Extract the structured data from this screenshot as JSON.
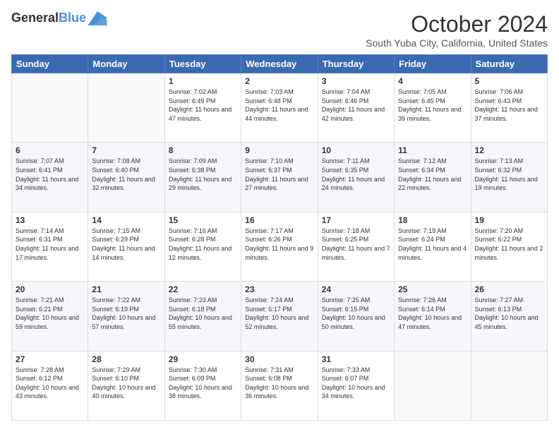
{
  "header": {
    "logo_line1": "General",
    "logo_line2": "Blue",
    "month": "October 2024",
    "location": "South Yuba City, California, United States"
  },
  "days": [
    "Sunday",
    "Monday",
    "Tuesday",
    "Wednesday",
    "Thursday",
    "Friday",
    "Saturday"
  ],
  "weeks": [
    [
      {
        "day": "",
        "info": ""
      },
      {
        "day": "",
        "info": ""
      },
      {
        "day": "1",
        "info": "Sunrise: 7:02 AM\nSunset: 6:49 PM\nDaylight: 11 hours and 47 minutes."
      },
      {
        "day": "2",
        "info": "Sunrise: 7:03 AM\nSunset: 6:48 PM\nDaylight: 11 hours and 44 minutes."
      },
      {
        "day": "3",
        "info": "Sunrise: 7:04 AM\nSunset: 6:46 PM\nDaylight: 11 hours and 42 minutes."
      },
      {
        "day": "4",
        "info": "Sunrise: 7:05 AM\nSunset: 6:45 PM\nDaylight: 11 hours and 39 minutes."
      },
      {
        "day": "5",
        "info": "Sunrise: 7:06 AM\nSunset: 6:43 PM\nDaylight: 11 hours and 37 minutes."
      }
    ],
    [
      {
        "day": "6",
        "info": "Sunrise: 7:07 AM\nSunset: 6:41 PM\nDaylight: 11 hours and 34 minutes."
      },
      {
        "day": "7",
        "info": "Sunrise: 7:08 AM\nSunset: 6:40 PM\nDaylight: 11 hours and 32 minutes."
      },
      {
        "day": "8",
        "info": "Sunrise: 7:09 AM\nSunset: 6:38 PM\nDaylight: 11 hours and 29 minutes."
      },
      {
        "day": "9",
        "info": "Sunrise: 7:10 AM\nSunset: 6:37 PM\nDaylight: 11 hours and 27 minutes."
      },
      {
        "day": "10",
        "info": "Sunrise: 7:11 AM\nSunset: 6:35 PM\nDaylight: 11 hours and 24 minutes."
      },
      {
        "day": "11",
        "info": "Sunrise: 7:12 AM\nSunset: 6:34 PM\nDaylight: 11 hours and 22 minutes."
      },
      {
        "day": "12",
        "info": "Sunrise: 7:13 AM\nSunset: 6:32 PM\nDaylight: 11 hours and 19 minutes."
      }
    ],
    [
      {
        "day": "13",
        "info": "Sunrise: 7:14 AM\nSunset: 6:31 PM\nDaylight: 11 hours and 17 minutes."
      },
      {
        "day": "14",
        "info": "Sunrise: 7:15 AM\nSunset: 6:29 PM\nDaylight: 11 hours and 14 minutes."
      },
      {
        "day": "15",
        "info": "Sunrise: 7:16 AM\nSunset: 6:28 PM\nDaylight: 11 hours and 12 minutes."
      },
      {
        "day": "16",
        "info": "Sunrise: 7:17 AM\nSunset: 6:26 PM\nDaylight: 11 hours and 9 minutes."
      },
      {
        "day": "17",
        "info": "Sunrise: 7:18 AM\nSunset: 6:25 PM\nDaylight: 11 hours and 7 minutes."
      },
      {
        "day": "18",
        "info": "Sunrise: 7:19 AM\nSunset: 6:24 PM\nDaylight: 11 hours and 4 minutes."
      },
      {
        "day": "19",
        "info": "Sunrise: 7:20 AM\nSunset: 6:22 PM\nDaylight: 11 hours and 2 minutes."
      }
    ],
    [
      {
        "day": "20",
        "info": "Sunrise: 7:21 AM\nSunset: 6:21 PM\nDaylight: 10 hours and 59 minutes."
      },
      {
        "day": "21",
        "info": "Sunrise: 7:22 AM\nSunset: 6:19 PM\nDaylight: 10 hours and 57 minutes."
      },
      {
        "day": "22",
        "info": "Sunrise: 7:23 AM\nSunset: 6:18 PM\nDaylight: 10 hours and 55 minutes."
      },
      {
        "day": "23",
        "info": "Sunrise: 7:24 AM\nSunset: 6:17 PM\nDaylight: 10 hours and 52 minutes."
      },
      {
        "day": "24",
        "info": "Sunrise: 7:25 AM\nSunset: 6:15 PM\nDaylight: 10 hours and 50 minutes."
      },
      {
        "day": "25",
        "info": "Sunrise: 7:26 AM\nSunset: 6:14 PM\nDaylight: 10 hours and 47 minutes."
      },
      {
        "day": "26",
        "info": "Sunrise: 7:27 AM\nSunset: 6:13 PM\nDaylight: 10 hours and 45 minutes."
      }
    ],
    [
      {
        "day": "27",
        "info": "Sunrise: 7:28 AM\nSunset: 6:12 PM\nDaylight: 10 hours and 43 minutes."
      },
      {
        "day": "28",
        "info": "Sunrise: 7:29 AM\nSunset: 6:10 PM\nDaylight: 10 hours and 40 minutes."
      },
      {
        "day": "29",
        "info": "Sunrise: 7:30 AM\nSunset: 6:09 PM\nDaylight: 10 hours and 38 minutes."
      },
      {
        "day": "30",
        "info": "Sunrise: 7:31 AM\nSunset: 6:08 PM\nDaylight: 10 hours and 36 minutes."
      },
      {
        "day": "31",
        "info": "Sunrise: 7:33 AM\nSunset: 6:07 PM\nDaylight: 10 hours and 34 minutes."
      },
      {
        "day": "",
        "info": ""
      },
      {
        "day": "",
        "info": ""
      }
    ]
  ]
}
